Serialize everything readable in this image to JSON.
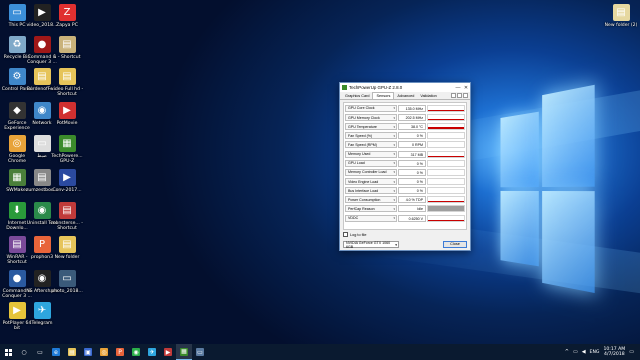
{
  "desktop": {
    "icons": [
      {
        "label": "This PC",
        "glyph": "▭",
        "color": "#3c8fd8"
      },
      {
        "label": "video_2018...",
        "glyph": "▶",
        "color": "#222222"
      },
      {
        "label": "Zapya PC",
        "glyph": "Z",
        "color": "#e03030"
      },
      {
        "label": "Recycle Bin",
        "glyph": "♻",
        "color": "#7fa9c9"
      },
      {
        "label": "Command & Conquer 3 ...",
        "glyph": "●",
        "color": "#a01818"
      },
      {
        "label": "1 - Shortcut",
        "glyph": "▤",
        "color": "#c9b27a"
      },
      {
        "label": "Control Panel",
        "glyph": "⚙",
        "color": "#3f87c9"
      },
      {
        "label": "BurdenofFe...",
        "glyph": "▤",
        "color": "#e6c45a"
      },
      {
        "label": "video Full hd - Shortcut",
        "glyph": "▤",
        "color": "#e6c45a"
      },
      {
        "label": "GeForce Experience",
        "glyph": "◆",
        "color": "#333333"
      },
      {
        "label": "Network",
        "glyph": "◉",
        "color": "#3f87c9"
      },
      {
        "label": "PotMovie",
        "glyph": "▶",
        "color": "#d03030"
      },
      {
        "label": "Google Chrome",
        "glyph": "◎",
        "color": "#e8a33a"
      },
      {
        "label": "ضبط",
        "glyph": "▭",
        "color": "#dddddd"
      },
      {
        "label": "TechPowere... GPU-Z",
        "glyph": "▦",
        "color": "#3b8b2b"
      },
      {
        "label": "SWMaker",
        "glyph": "▦",
        "color": "#4a7f3a"
      },
      {
        "label": "zumzestboo...",
        "glyph": "▤",
        "color": "#888888"
      },
      {
        "label": "Conv-2017...",
        "glyph": "▶",
        "color": "#2b4aa0"
      },
      {
        "label": "Internet Downlo...",
        "glyph": "⬇",
        "color": "#2a9a3a"
      },
      {
        "label": "Uninstall Tool",
        "glyph": "◉",
        "color": "#2a8a4a"
      },
      {
        "label": "monsterse... - Shortcut",
        "glyph": "▤",
        "color": "#c03a3a"
      },
      {
        "label": "WinRAR - Shortcut",
        "glyph": "▤",
        "color": "#7a4a9a"
      },
      {
        "label": "prophon3",
        "glyph": "P",
        "color": "#e8643a"
      },
      {
        "label": "New folder",
        "glyph": "▤",
        "color": "#e6c45a"
      },
      {
        "label": "Command & Conquer 3 ...",
        "glyph": "●",
        "color": "#2a5aa0"
      },
      {
        "label": "NS Aftershare",
        "glyph": "◉",
        "color": "#222222"
      },
      {
        "label": "photo_2018...",
        "glyph": "▭",
        "color": "#3a5a7a"
      },
      {
        "label": "PotPlayer 64 bit",
        "glyph": "▶",
        "color": "#e6c43a"
      },
      {
        "label": "Telegram",
        "glyph": "✈",
        "color": "#2ea6de"
      },
      {
        "label": "New folder (2)",
        "glyph": "▤",
        "color": "#e6d8a0"
      }
    ]
  },
  "gpuz": {
    "title": "TechPowerUp GPU-Z 2.8.0",
    "minimize": "—",
    "close": "✕",
    "tabs": [
      "Graphics Card",
      "Sensors",
      "Advanced",
      "Validation"
    ],
    "sensors": [
      {
        "name": "GPU Core Clock",
        "value": "135.0 MHz",
        "level": 0.08,
        "grey": false
      },
      {
        "name": "GPU Memory Clock",
        "value": "202.5 MHz",
        "level": 0.08,
        "grey": false
      },
      {
        "name": "GPU Temperature",
        "value": "38.0 °C",
        "level": 0.3,
        "grey": false
      },
      {
        "name": "Fan Speed (%)",
        "value": "0 %",
        "level": 0.0,
        "grey": false
      },
      {
        "name": "Fan Speed (RPM)",
        "value": "0 RPM",
        "level": 0.0,
        "grey": false
      },
      {
        "name": "Memory Used",
        "value": "317 MB",
        "level": 0.1,
        "grey": false
      },
      {
        "name": "GPU Load",
        "value": "0 %",
        "level": 0.0,
        "grey": false
      },
      {
        "name": "Memory Controller Load",
        "value": "0 %",
        "level": 0.0,
        "grey": false
      },
      {
        "name": "Video Engine Load",
        "value": "0 %",
        "level": 0.0,
        "grey": false
      },
      {
        "name": "Bus Interface Load",
        "value": "0 %",
        "level": 0.0,
        "grey": false
      },
      {
        "name": "Power Consumption",
        "value": "4.0 % TDP",
        "level": 0.06,
        "grey": false
      },
      {
        "name": "PerfCap Reason",
        "value": "Idle",
        "level": 1.0,
        "grey": true
      },
      {
        "name": "VDDC",
        "value": "0.6250 V",
        "level": 0.12,
        "grey": false
      }
    ],
    "log_label": "Log to file",
    "gpu_select": "NVIDIA GeForce GTX 1060 6GB",
    "close_label": "Close"
  },
  "taskbar": {
    "apps": [
      {
        "name": "search",
        "glyph": "○",
        "color": "transparent"
      },
      {
        "name": "task-view",
        "glyph": "▭",
        "color": "transparent"
      },
      {
        "name": "edge",
        "glyph": "e",
        "color": "#1f7bd8"
      },
      {
        "name": "file-explorer",
        "glyph": "▤",
        "color": "#e6c45a"
      },
      {
        "name": "store",
        "glyph": "▣",
        "color": "#3a6ad0"
      },
      {
        "name": "chrome",
        "glyph": "◎",
        "color": "#e8a33a"
      },
      {
        "name": "prophon",
        "glyph": "P",
        "color": "#e8643a"
      },
      {
        "name": "whatsapp",
        "glyph": "◉",
        "color": "#2bb04a"
      },
      {
        "name": "telegram",
        "glyph": "✈",
        "color": "#2ea6de"
      },
      {
        "name": "media",
        "glyph": "▶",
        "color": "#c03a3a"
      },
      {
        "name": "gpu-z",
        "glyph": "▦",
        "color": "#3b8b2b"
      },
      {
        "name": "photos",
        "glyph": "▭",
        "color": "#5a7aa0"
      }
    ],
    "tray_chevron": "^",
    "tray_network": "▭",
    "tray_volume": "◀",
    "language": "ENG",
    "time": "10:17 AM",
    "date": "4/7/2018",
    "notification": "▭"
  }
}
